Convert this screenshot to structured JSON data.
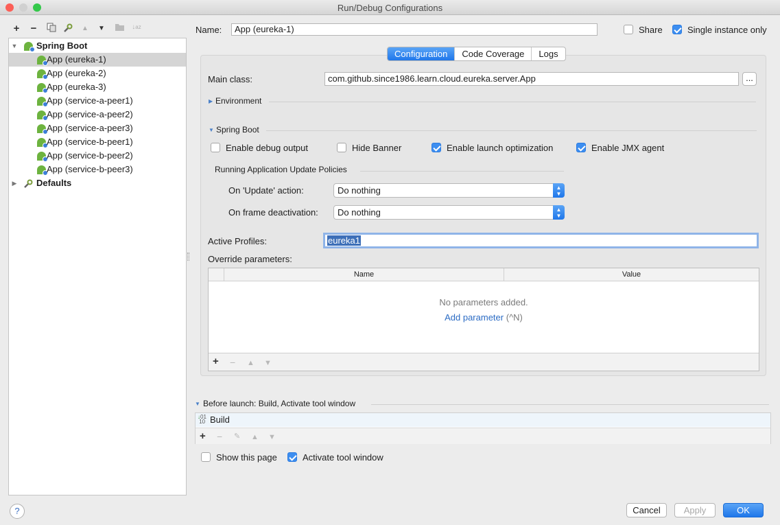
{
  "window": {
    "title": "Run/Debug Configurations"
  },
  "toolbar": {
    "add": "+",
    "remove": "−",
    "copy_icon": "copy-icon",
    "edit_defaults_icon": "wrench-icon",
    "move_up": "▲",
    "move_down": "▼",
    "folder_icon": "folder-icon",
    "sort_icon": "sort-icon"
  },
  "tree": {
    "group_label": "Spring Boot",
    "items": [
      {
        "label": "App (eureka-1)",
        "selected": true
      },
      {
        "label": "App (eureka-2)"
      },
      {
        "label": "App (eureka-3)"
      },
      {
        "label": "App (service-a-peer1)"
      },
      {
        "label": "App (service-a-peer2)"
      },
      {
        "label": "App (service-a-peer3)"
      },
      {
        "label": "App (service-b-peer1)"
      },
      {
        "label": "App (service-b-peer2)"
      },
      {
        "label": "App (service-b-peer3)"
      }
    ],
    "defaults_label": "Defaults"
  },
  "header": {
    "name_label": "Name:",
    "name_value": "App (eureka-1)",
    "share_label": "Share",
    "share_checked": false,
    "single_instance_label": "Single instance only",
    "single_instance_checked": true
  },
  "tabs": [
    "Configuration",
    "Code Coverage",
    "Logs"
  ],
  "config": {
    "main_class_label": "Main class:",
    "main_class_value": "com.github.since1986.learn.cloud.eureka.server.App",
    "browse_label": "...",
    "environment_label": "Environment",
    "spring_boot_label": "Spring Boot",
    "checkboxes": [
      {
        "label": "Enable debug output",
        "checked": false
      },
      {
        "label": "Hide Banner",
        "checked": false
      },
      {
        "label": "Enable launch optimization",
        "checked": true
      },
      {
        "label": "Enable JMX agent",
        "checked": true
      }
    ],
    "policies_label": "Running Application Update Policies",
    "update_action_label": "On 'Update' action:",
    "update_action_value": "Do nothing",
    "frame_deactivation_label": "On frame deactivation:",
    "frame_deactivation_value": "Do nothing",
    "active_profiles_label": "Active Profiles:",
    "active_profiles_value": "eureka1",
    "override_label": "Override parameters:",
    "table": {
      "columns": [
        "Name",
        "Value"
      ],
      "empty_text": "No parameters added.",
      "add_link": "Add parameter",
      "add_shortcut": "(^N)"
    }
  },
  "before_launch": {
    "header": "Before launch: Build, Activate tool window",
    "task": "Build",
    "show_page_label": "Show this page",
    "show_page_checked": false,
    "activate_label": "Activate tool window",
    "activate_checked": true
  },
  "buttons": {
    "help": "?",
    "cancel": "Cancel",
    "apply": "Apply",
    "ok": "OK"
  },
  "colors": {
    "accent": "#1f77ea",
    "spring": "#6db33f"
  }
}
